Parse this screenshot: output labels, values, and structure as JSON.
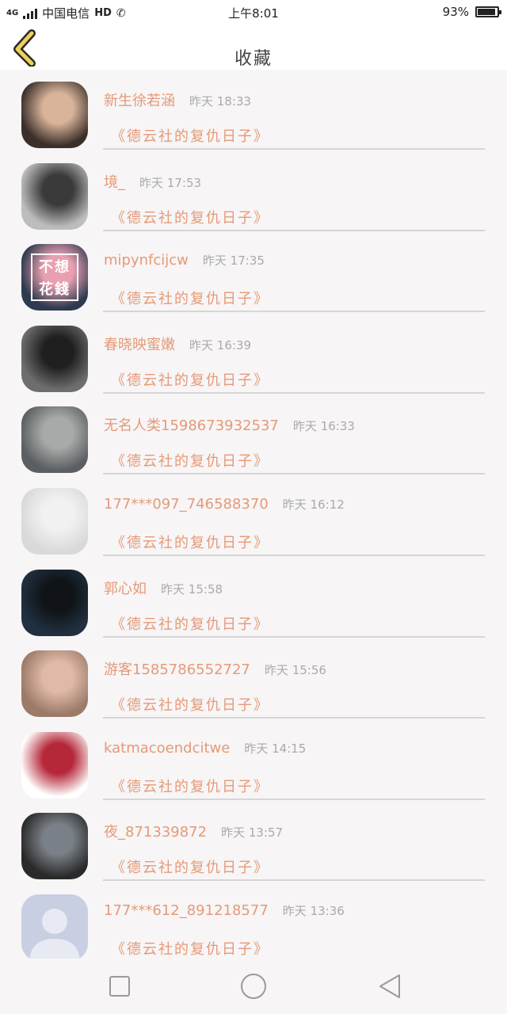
{
  "status": {
    "left_text": "中国电信",
    "network": "4G",
    "hd": "HD",
    "time": "上午8:01",
    "battery_text": "93%",
    "battery_level": 0.93
  },
  "header": {
    "title": "收藏"
  },
  "items": [
    {
      "name": "新生徐若涵",
      "date": "昨天",
      "time": "18:33",
      "book": "《德云社的复仇日子》",
      "avatar_colors": [
        "#3b2f2a",
        "#d9b49a"
      ]
    },
    {
      "name": "境_",
      "date": "昨天",
      "time": "17:53",
      "book": "《德云社的复仇日子》",
      "avatar_colors": [
        "#bdbdbd",
        "#3a3a3a"
      ]
    },
    {
      "name": "mipynfcijcw",
      "date": "昨天",
      "time": "17:35",
      "book": "《德云社的复仇日子》",
      "avatar_colors": [
        "#2e3a4f",
        "#e8a0b0"
      ],
      "avatar_text": "不想花錢"
    },
    {
      "name": "春晓映蜜嫩",
      "date": "昨天",
      "time": "16:39",
      "book": "《德云社的复仇日子》",
      "avatar_colors": [
        "#6e6e6e",
        "#1f1f1f"
      ]
    },
    {
      "name": "无名人类1598673932537",
      "date": "昨天",
      "time": "16:33",
      "book": "《德云社的复仇日子》",
      "avatar_colors": [
        "#5c5f62",
        "#a7aaa8"
      ]
    },
    {
      "name": "177***097_746588370",
      "date": "昨天",
      "time": "16:12",
      "book": "《德云社的复仇日子》",
      "avatar_colors": [
        "#d8dad8",
        "#f1f1f1"
      ]
    },
    {
      "name": "郭心如",
      "date": "昨天",
      "time": "15:58",
      "book": "《德云社的复仇日子》",
      "avatar_colors": [
        "#203040",
        "#101418"
      ]
    },
    {
      "name": "游客1585786552727",
      "date": "昨天",
      "time": "15:56",
      "book": "《德云社的复仇日子》",
      "avatar_colors": [
        "#9b7a68",
        "#e0b9a8"
      ]
    },
    {
      "name": "katmacoendcitwe",
      "date": "昨天",
      "time": "14:15",
      "book": "《德云社的复仇日子》",
      "avatar_colors": [
        "#ffffff",
        "#b5283a"
      ]
    },
    {
      "name": "夜_871339872",
      "date": "昨天",
      "time": "13:57",
      "book": "《德云社的复仇日子》",
      "avatar_colors": [
        "#2a2a2a",
        "#7a8087"
      ]
    },
    {
      "name": "177***612_891218577",
      "date": "昨天",
      "time": "13:36",
      "book": "《德云社的复仇日子》",
      "avatar_colors": [
        "#c9cfe2",
        "#e7eaf3"
      ]
    }
  ],
  "icons": {
    "back": "chevron-left-icon",
    "nav_recent": "square-icon",
    "nav_home": "circle-icon",
    "nav_back": "triangle-back-icon"
  },
  "colors": {
    "accent": "#e59a77",
    "back_arrow": "#ecd25a",
    "time": "#aaaaaa"
  }
}
